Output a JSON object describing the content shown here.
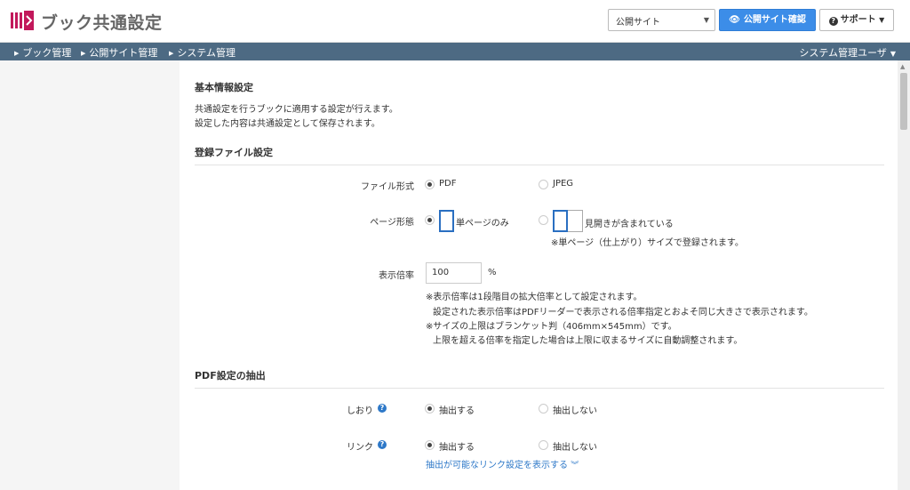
{
  "header": {
    "title": "ブック共通設定",
    "site_select": {
      "value": "公開サイト"
    },
    "confirm_button": "公開サイト確認",
    "support_button": "サポート",
    "brand_color": "#3c8de8"
  },
  "nav": {
    "items": [
      {
        "label": "ブック管理"
      },
      {
        "label": "公開サイト管理"
      },
      {
        "label": "システム管理"
      }
    ],
    "user": "システム管理ユーザ",
    "bg_color": "#4d6a83"
  },
  "basic": {
    "title": "基本情報設定",
    "desc1": "共通設定を行うブックに適用する設定が行えます。",
    "desc2": "設定した内容は共通設定として保存されます。"
  },
  "file": {
    "title": "登録ファイル設定",
    "format_label": "ファイル形式",
    "format_options": [
      "PDF",
      "JPEG"
    ],
    "page_label": "ページ形態",
    "page_options": [
      "単ページのみ",
      "見開きが含まれている"
    ],
    "page_note": "※単ページ（仕上がり）サイズで登録されます。",
    "zoom_label": "表示倍率",
    "zoom_value": "100",
    "zoom_unit": "%",
    "zoom_notes": [
      "※表示倍率は1段階目の拡大倍率として設定されます。",
      "設定された表示倍率はPDFリーダーで表示される倍率指定とおよそ同じ大きさで表示されます。",
      "※サイズの上限はブランケット判（406mm×545mm）です。",
      "上限を超える倍率を指定した場合は上限に収まるサイズに自動調整されます。"
    ]
  },
  "pdf": {
    "title": "PDF設定の抽出",
    "bookmark_label": "しおり",
    "link_label": "リンク",
    "options": [
      "抽出する",
      "抽出しない"
    ],
    "link_expand": "抽出が可能なリンク設定を表示する"
  }
}
